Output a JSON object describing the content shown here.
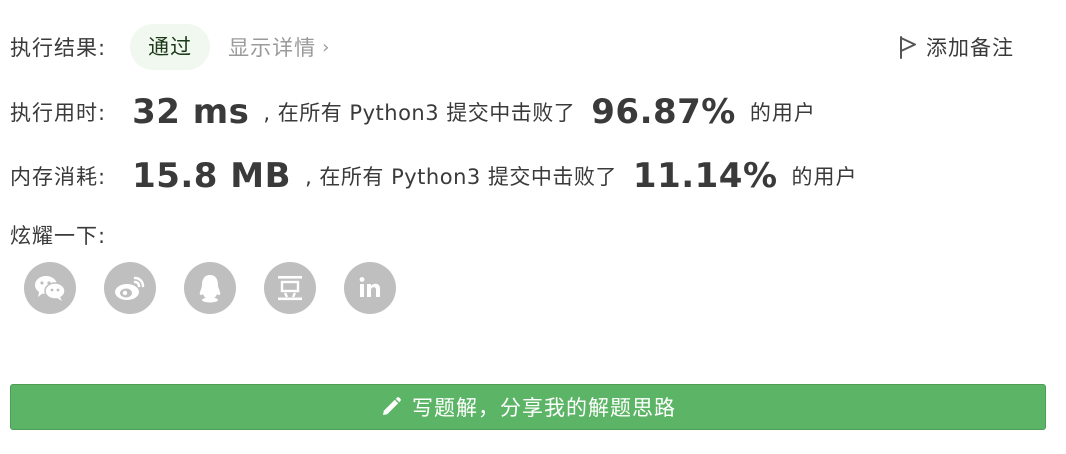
{
  "result": {
    "label": "执行结果:",
    "status": "通过",
    "details_link": "显示详情",
    "details_chevron": "›"
  },
  "note_button": {
    "label": "添加备注",
    "icon": "flag-icon"
  },
  "runtime": {
    "label": "执行用时:",
    "value": "32 ms",
    "middle_text": ", 在所有 Python3 提交中击败了",
    "percent": "96.87%",
    "suffix": "的用户"
  },
  "memory": {
    "label": "内存消耗:",
    "value": "15.8 MB",
    "middle_text": ", 在所有 Python3 提交中击败了",
    "percent": "11.14%",
    "suffix": "的用户"
  },
  "share": {
    "label": "炫耀一下:",
    "icons": [
      "wechat-icon",
      "weibo-icon",
      "qq-icon",
      "douban-icon",
      "linkedin-icon"
    ]
  },
  "solution_button": {
    "label": "写题解，分享我的解题思路",
    "icon": "pencil-icon"
  },
  "colors": {
    "accent_green": "#5cb566",
    "badge_bg": "#f1f8f0",
    "share_icon_bg": "#bfbfbf",
    "muted_text": "#9a9a9a"
  }
}
